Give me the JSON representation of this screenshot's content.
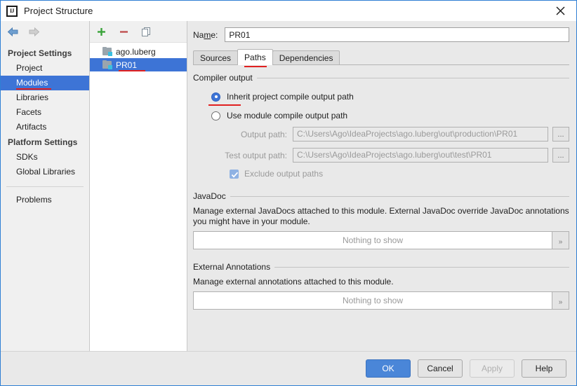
{
  "window": {
    "title": "Project Structure",
    "app_icon": "intellij-idea-icon",
    "icon_text": "IJ",
    "close_label": "×",
    "accent_color": "#3d74d6",
    "annotation_color": "#e02020"
  },
  "nav": {
    "back_icon": "arrow-left-icon",
    "forward_icon": "arrow-right-icon"
  },
  "sidebar": {
    "groups": [
      {
        "title": "Project Settings",
        "items": [
          {
            "label": "Project",
            "selected": false,
            "annotated": false
          },
          {
            "label": "Modules",
            "selected": true,
            "annotated": true
          },
          {
            "label": "Libraries",
            "selected": false,
            "annotated": false
          },
          {
            "label": "Facets",
            "selected": false,
            "annotated": false
          },
          {
            "label": "Artifacts",
            "selected": false,
            "annotated": false
          }
        ]
      },
      {
        "title": "Platform Settings",
        "items": [
          {
            "label": "SDKs",
            "selected": false,
            "annotated": false
          },
          {
            "label": "Global Libraries",
            "selected": false,
            "annotated": false
          }
        ]
      }
    ],
    "problems": {
      "label": "Problems"
    }
  },
  "tree": {
    "toolbar": {
      "add_icon": "plus-icon",
      "remove_icon": "minus-icon",
      "copy_icon": "copy-icon"
    },
    "modules": [
      {
        "label": "ago.luberg",
        "selected": false,
        "annotated": false
      },
      {
        "label": "PR01",
        "selected": true,
        "annotated": true
      }
    ]
  },
  "name_field": {
    "label": "Name:",
    "label_prefix": "Na",
    "label_mnemonic": "m",
    "label_suffix": "e:",
    "value": "PR01"
  },
  "tabs": [
    {
      "label": "Sources",
      "active": false,
      "annotated": false
    },
    {
      "label": "Paths",
      "active": true,
      "annotated": true
    },
    {
      "label": "Dependencies",
      "active": false,
      "annotated": false
    }
  ],
  "compiler_output": {
    "group_title": "Compiler output",
    "radio_inherit": {
      "label": "Inherit project compile output path",
      "selected": true,
      "annotated": true
    },
    "radio_module": {
      "label": "Use module compile output path",
      "selected": false,
      "annotated": false
    },
    "output_path": {
      "label": "Output path:",
      "value": "C:\\Users\\Ago\\IdeaProjects\\ago.luberg\\out\\production\\PR01",
      "browse_label": "..."
    },
    "test_output_path": {
      "label": "Test output path:",
      "value": "C:\\Users\\Ago\\IdeaProjects\\ago.luberg\\out\\test\\PR01",
      "browse_label": "..."
    },
    "exclude_checkbox": {
      "label": "Exclude output paths",
      "checked": true,
      "enabled": false
    }
  },
  "javadoc": {
    "group_title": "JavaDoc",
    "description": "Manage external JavaDocs attached to this module. External JavaDoc override JavaDoc annotations you might have in your module.",
    "empty_text": "Nothing to show",
    "expand_label": "»"
  },
  "external_annotations": {
    "group_title": "External Annotations",
    "description": "Manage external annotations attached to this module.",
    "empty_text": "Nothing to show",
    "expand_label": "»"
  },
  "footer": {
    "ok": "OK",
    "cancel": "Cancel",
    "apply": "Apply",
    "help": "Help"
  }
}
